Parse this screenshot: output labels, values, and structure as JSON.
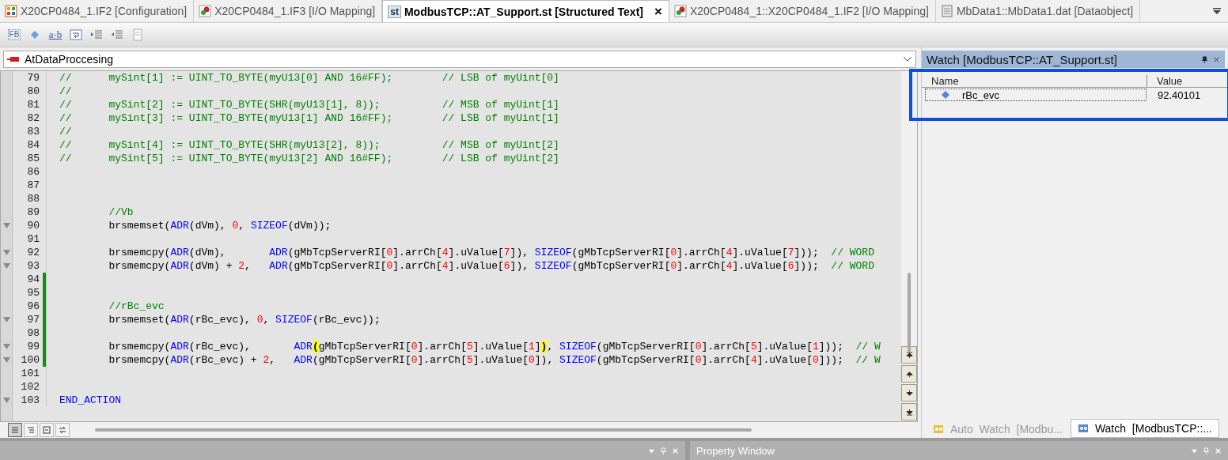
{
  "tabs": [
    {
      "kind": "config",
      "label": "X20CP0484_1.IF2 [Configuration]",
      "selected": false
    },
    {
      "kind": "mapping",
      "label": "X20CP0484_1.IF3 [I/O Mapping]",
      "selected": false
    },
    {
      "kind": "source",
      "icon_label": "st",
      "label": "ModbusTCP::AT_Support.st [Structured Text]",
      "selected": true,
      "close": "×"
    },
    {
      "kind": "mapping",
      "label": "X20CP0484_1::X20CP0484_1.IF2 [I/O Mapping]",
      "selected": false
    },
    {
      "kind": "data",
      "label": "MbData1::MbData1.dat [Dataobject]",
      "selected": false
    }
  ],
  "toolbar": [
    {
      "kind": "fb",
      "label": "FB"
    },
    {
      "kind": "diamond"
    },
    {
      "kind": "ab",
      "label": "a·b"
    },
    {
      "kind": "wrap"
    },
    {
      "kind": "indent"
    },
    {
      "kind": "outdent"
    },
    {
      "kind": "page"
    }
  ],
  "action_selector": {
    "value": "AtDataProccesing"
  },
  "code_lines": [
    {
      "num": "79",
      "marker": false,
      "changed": false,
      "tokens": [
        {
          "kind": "cmt",
          "text": "//      mySint[1] := UINT_TO_BYTE(myU13[0] AND 16#FF);        // LSB of myUint[0]"
        }
      ]
    },
    {
      "num": "80",
      "marker": false,
      "changed": false,
      "tokens": [
        {
          "kind": "cmt",
          "text": "//"
        }
      ]
    },
    {
      "num": "81",
      "marker": false,
      "changed": false,
      "tokens": [
        {
          "kind": "cmt",
          "text": "//      mySint[2] := UINT_TO_BYTE(SHR(myU13[1], 8));          // MSB of myUint[1]"
        }
      ]
    },
    {
      "num": "82",
      "marker": false,
      "changed": false,
      "tokens": [
        {
          "kind": "cmt",
          "text": "//      mySint[3] := UINT_TO_BYTE(myU13[1] AND 16#FF);        // LSB of myUint[1]"
        }
      ]
    },
    {
      "num": "83",
      "marker": false,
      "changed": false,
      "tokens": [
        {
          "kind": "cmt",
          "text": "//"
        }
      ]
    },
    {
      "num": "84",
      "marker": false,
      "changed": false,
      "tokens": [
        {
          "kind": "cmt",
          "text": "//      mySint[4] := UINT_TO_BYTE(SHR(myU13[2], 8));          // MSB of myUint[2]"
        }
      ]
    },
    {
      "num": "85",
      "marker": false,
      "changed": false,
      "tokens": [
        {
          "kind": "cmt",
          "text": "//      mySint[5] := UINT_TO_BYTE(myU13[2] AND 16#FF);        // LSB of myUint[2]"
        }
      ]
    },
    {
      "num": "86",
      "marker": false,
      "changed": false
    },
    {
      "num": "87",
      "marker": false,
      "changed": false
    },
    {
      "num": "88",
      "marker": false,
      "changed": false
    },
    {
      "num": "89",
      "marker": false,
      "changed": false,
      "tokens": [
        {
          "kind": "cmt",
          "text": "        //Vb"
        }
      ]
    },
    {
      "num": "90",
      "marker": true,
      "changed": false,
      "tokens": [
        {
          "kind": "p",
          "text": "        brsmemset("
        },
        {
          "kind": "kw",
          "text": "ADR"
        },
        {
          "kind": "p",
          "text": "(dVm), "
        },
        {
          "kind": "num",
          "text": "0"
        },
        {
          "kind": "p",
          "text": ", "
        },
        {
          "kind": "kw",
          "text": "SIZEOF"
        },
        {
          "kind": "p",
          "text": "(dVm));"
        }
      ]
    },
    {
      "num": "91",
      "marker": false,
      "changed": false
    },
    {
      "num": "92",
      "marker": true,
      "changed": false,
      "tokens": [
        {
          "kind": "p",
          "text": "        brsmemcpy("
        },
        {
          "kind": "kw",
          "text": "ADR"
        },
        {
          "kind": "p",
          "text": "(dVm),       "
        },
        {
          "kind": "kw",
          "text": "ADR"
        },
        {
          "kind": "p",
          "text": "(gMbTcpServerRI["
        },
        {
          "kind": "num",
          "text": "0"
        },
        {
          "kind": "p",
          "text": "].arrCh["
        },
        {
          "kind": "num",
          "text": "4"
        },
        {
          "kind": "p",
          "text": "].uValue["
        },
        {
          "kind": "num",
          "text": "7"
        },
        {
          "kind": "p",
          "text": "]), "
        },
        {
          "kind": "kw",
          "text": "SIZEOF"
        },
        {
          "kind": "p",
          "text": "(gMbTcpServerRI["
        },
        {
          "kind": "num",
          "text": "0"
        },
        {
          "kind": "p",
          "text": "].arrCh["
        },
        {
          "kind": "num",
          "text": "4"
        },
        {
          "kind": "p",
          "text": "].uValue["
        },
        {
          "kind": "num",
          "text": "7"
        },
        {
          "kind": "p",
          "text": "]));  "
        },
        {
          "kind": "cmt",
          "text": "// WORD"
        }
      ]
    },
    {
      "num": "93",
      "marker": true,
      "changed": false,
      "tokens": [
        {
          "kind": "p",
          "text": "        brsmemcpy("
        },
        {
          "kind": "kw",
          "text": "ADR"
        },
        {
          "kind": "p",
          "text": "(dVm) + "
        },
        {
          "kind": "num",
          "text": "2"
        },
        {
          "kind": "p",
          "text": ",   "
        },
        {
          "kind": "kw",
          "text": "ADR"
        },
        {
          "kind": "p",
          "text": "(gMbTcpServerRI["
        },
        {
          "kind": "num",
          "text": "0"
        },
        {
          "kind": "p",
          "text": "].arrCh["
        },
        {
          "kind": "num",
          "text": "4"
        },
        {
          "kind": "p",
          "text": "].uValue["
        },
        {
          "kind": "num",
          "text": "6"
        },
        {
          "kind": "p",
          "text": "]), "
        },
        {
          "kind": "kw",
          "text": "SIZEOF"
        },
        {
          "kind": "p",
          "text": "(gMbTcpServerRI["
        },
        {
          "kind": "num",
          "text": "0"
        },
        {
          "kind": "p",
          "text": "].arrCh["
        },
        {
          "kind": "num",
          "text": "4"
        },
        {
          "kind": "p",
          "text": "].uValue["
        },
        {
          "kind": "num",
          "text": "6"
        },
        {
          "kind": "p",
          "text": "]));  "
        },
        {
          "kind": "cmt",
          "text": "// WORD"
        }
      ]
    },
    {
      "num": "94",
      "marker": false,
      "changed": true
    },
    {
      "num": "95",
      "marker": false,
      "changed": true
    },
    {
      "num": "96",
      "marker": false,
      "changed": true,
      "tokens": [
        {
          "kind": "cmt",
          "text": "        //rBc_evc"
        }
      ]
    },
    {
      "num": "97",
      "marker": true,
      "changed": true,
      "tokens": [
        {
          "kind": "p",
          "text": "        brsmemset("
        },
        {
          "kind": "kw",
          "text": "ADR"
        },
        {
          "kind": "p",
          "text": "(rBc_evc), "
        },
        {
          "kind": "num",
          "text": "0"
        },
        {
          "kind": "p",
          "text": ", "
        },
        {
          "kind": "kw",
          "text": "SIZEOF"
        },
        {
          "kind": "p",
          "text": "(rBc_evc));"
        }
      ]
    },
    {
      "num": "98",
      "marker": false,
      "changed": true
    },
    {
      "num": "99",
      "marker": true,
      "changed": true,
      "tokens": [
        {
          "kind": "p",
          "text": "        brsmemcpy("
        },
        {
          "kind": "kw",
          "text": "ADR"
        },
        {
          "kind": "p",
          "text": "(rBc_evc),       "
        },
        {
          "kind": "kw",
          "text": "ADR"
        },
        {
          "kind": "hl",
          "text": "("
        },
        {
          "kind": "p",
          "text": "gMbTcpServerRI["
        },
        {
          "kind": "num",
          "text": "0"
        },
        {
          "kind": "p",
          "text": "].arrCh["
        },
        {
          "kind": "num",
          "text": "5"
        },
        {
          "kind": "p",
          "text": "].uValue["
        },
        {
          "kind": "num",
          "text": "1"
        },
        {
          "kind": "p",
          "text": "]"
        },
        {
          "kind": "hl",
          "text": ")"
        },
        {
          "kind": "p",
          "text": ", "
        },
        {
          "kind": "kw",
          "text": "SIZEOF"
        },
        {
          "kind": "p",
          "text": "(gMbTcpServerRI["
        },
        {
          "kind": "num",
          "text": "0"
        },
        {
          "kind": "p",
          "text": "].arrCh["
        },
        {
          "kind": "num",
          "text": "5"
        },
        {
          "kind": "p",
          "text": "].uValue["
        },
        {
          "kind": "num",
          "text": "1"
        },
        {
          "kind": "p",
          "text": "]));  "
        },
        {
          "kind": "cmt",
          "text": "// W"
        }
      ]
    },
    {
      "num": "100",
      "marker": true,
      "changed": true,
      "tokens": [
        {
          "kind": "p",
          "text": "        brsmemcpy("
        },
        {
          "kind": "kw",
          "text": "ADR"
        },
        {
          "kind": "p",
          "text": "(rBc_evc) + "
        },
        {
          "kind": "num",
          "text": "2"
        },
        {
          "kind": "p",
          "text": ",   "
        },
        {
          "kind": "kw",
          "text": "ADR"
        },
        {
          "kind": "p",
          "text": "(gMbTcpServerRI["
        },
        {
          "kind": "num",
          "text": "0"
        },
        {
          "kind": "p",
          "text": "].arrCh["
        },
        {
          "kind": "num",
          "text": "5"
        },
        {
          "kind": "p",
          "text": "].uValue["
        },
        {
          "kind": "num",
          "text": "0"
        },
        {
          "kind": "p",
          "text": "]), "
        },
        {
          "kind": "kw",
          "text": "SIZEOF"
        },
        {
          "kind": "p",
          "text": "(gMbTcpServerRI["
        },
        {
          "kind": "num",
          "text": "0"
        },
        {
          "kind": "p",
          "text": "].arrCh["
        },
        {
          "kind": "num",
          "text": "4"
        },
        {
          "kind": "p",
          "text": "].uValue["
        },
        {
          "kind": "num",
          "text": "0"
        },
        {
          "kind": "p",
          "text": "]));  "
        },
        {
          "kind": "cmt",
          "text": "// W"
        }
      ]
    },
    {
      "num": "101",
      "marker": false,
      "changed": false
    },
    {
      "num": "102",
      "marker": false,
      "changed": false
    },
    {
      "num": "103",
      "marker": true,
      "changed": false,
      "tokens": [
        {
          "kind": "kw",
          "text": "END_ACTION"
        }
      ]
    }
  ],
  "view_buttons": [
    {
      "kind": "lines",
      "selected": true
    },
    {
      "kind": "outline",
      "selected": false
    },
    {
      "kind": "box",
      "selected": false
    },
    {
      "kind": "swap",
      "selected": false
    }
  ],
  "watch": {
    "title": "Watch [ModbusTCP::AT_Support.st]",
    "columns": [
      "Name",
      "Value"
    ],
    "rows": [
      {
        "name": "rBc_evc",
        "value": "92.40101"
      }
    ],
    "tabs": [
      {
        "label": "Auto  Watch  [Modbu...",
        "selected": false
      },
      {
        "label": "Watch  [ModbusTCP::...",
        "selected": true
      }
    ]
  },
  "property_panel": {
    "title": "Property Window"
  }
}
